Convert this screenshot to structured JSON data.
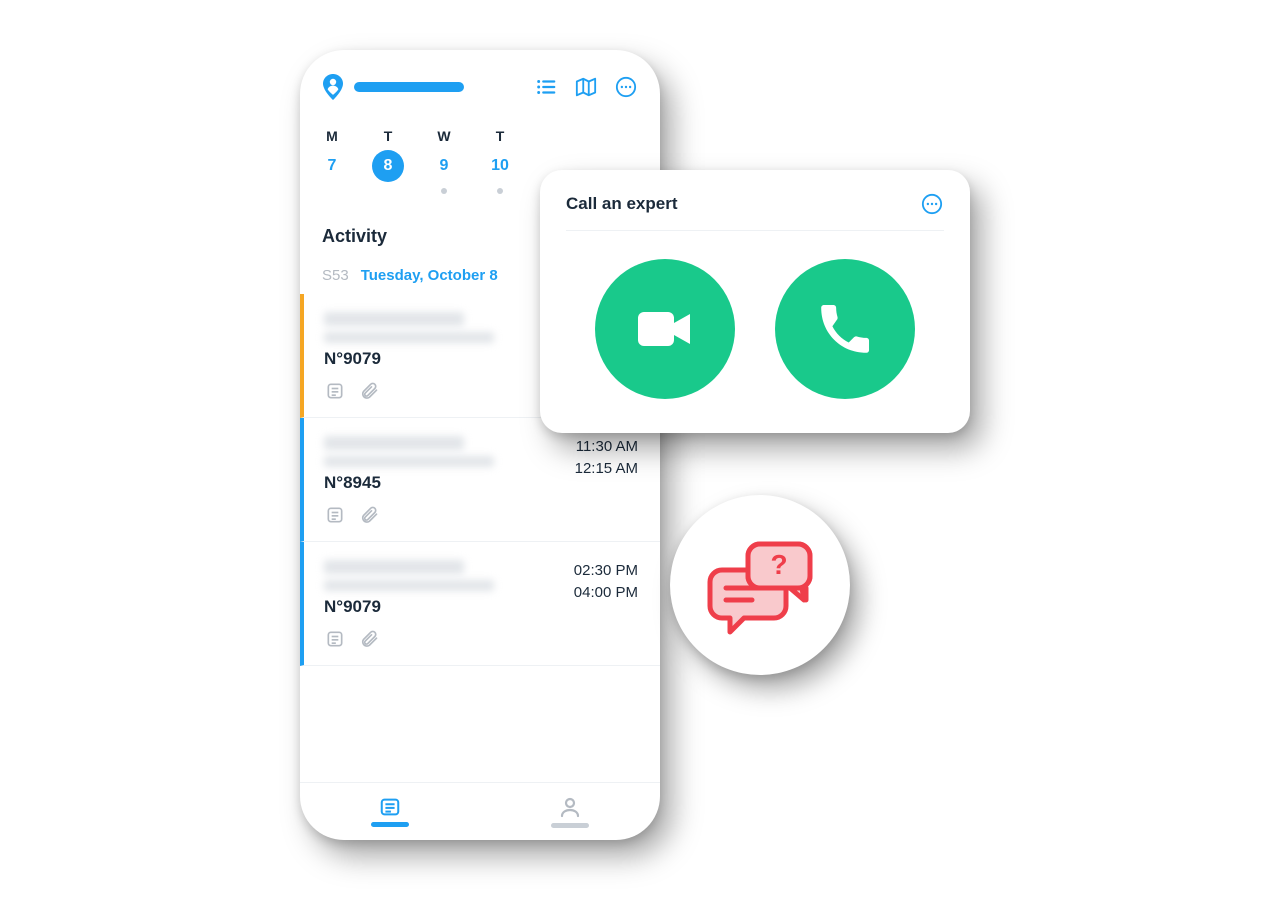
{
  "colors": {
    "primary": "#1E9FF2",
    "accentOrange": "#F5A623",
    "accentGreen": "#19C98B",
    "accentRed": "#EF3E4A",
    "iconGray": "#b4bac2",
    "text": "#1b2a3a"
  },
  "header": {
    "icons": [
      "user-pin",
      "list",
      "map",
      "more"
    ]
  },
  "days": [
    {
      "label": "M",
      "num": "7",
      "selected": false,
      "dot": false
    },
    {
      "label": "T",
      "num": "8",
      "selected": true,
      "dot": false
    },
    {
      "label": "W",
      "num": "9",
      "selected": false,
      "dot": true
    },
    {
      "label": "T",
      "num": "10",
      "selected": false,
      "dot": true
    }
  ],
  "section_title": "Activity",
  "week_label": "S53",
  "date_label": "Tuesday, October 8",
  "items": [
    {
      "color": "orange",
      "number": "N°9079",
      "time1": "",
      "time2": ""
    },
    {
      "color": "blue",
      "number": "N°8945",
      "time1": "11:30 AM",
      "time2": "12:15 AM"
    },
    {
      "color": "blue",
      "number": "N°9079",
      "time1": "02:30 PM",
      "time2": "04:00 PM"
    }
  ],
  "tabs": {
    "active": "list",
    "items": [
      "list",
      "profile"
    ]
  },
  "call_card": {
    "title": "Call an expert",
    "buttons": [
      "video-call",
      "voice-call"
    ]
  },
  "chat_badge": {
    "icon": "help-chat"
  }
}
